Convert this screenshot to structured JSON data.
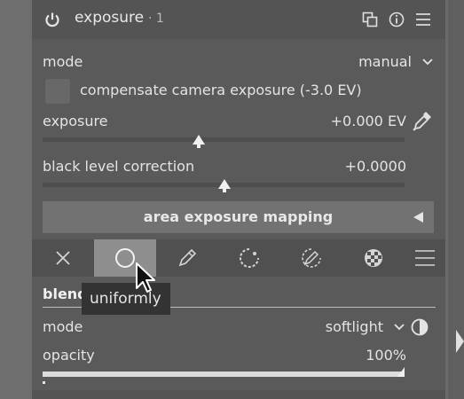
{
  "header": {
    "title": "exposure",
    "instance": "· 1",
    "icons": [
      "power-icon",
      "multi-instance-icon",
      "reset-icon",
      "presets-icon"
    ]
  },
  "mode": {
    "label": "mode",
    "value": "manual"
  },
  "compensate": {
    "label": "compensate camera exposure (-3.0 EV)",
    "checked": false
  },
  "exposure": {
    "label": "exposure",
    "value": "+0.000 EV",
    "picker_icon": "color-picker-icon"
  },
  "black_level": {
    "label": "black level correction",
    "value": "+0.0000"
  },
  "area_mapping": {
    "label": "area exposure mapping",
    "collapsed": true
  },
  "blend_modes": [
    {
      "name": "off",
      "icon": "close-icon"
    },
    {
      "name": "uniformly",
      "icon": "circle-icon",
      "active": true
    },
    {
      "name": "drawn mask",
      "icon": "pencil-icon"
    },
    {
      "name": "parametric mask",
      "icon": "parametric-icon"
    },
    {
      "name": "drawn & parametric mask",
      "icon": "pencil-parametric-icon"
    },
    {
      "name": "raster mask",
      "icon": "raster-icon"
    },
    {
      "name": "menu",
      "icon": "hamburger-icon"
    }
  ],
  "tooltip": {
    "text": "uniformly"
  },
  "blend": {
    "header": "blend",
    "mode_label": "mode",
    "mode_value": "softlight",
    "opacity_label": "opacity",
    "opacity_value": "100%",
    "opacity_fraction": 1.0
  },
  "colors": {
    "panel": "#5a5a5a",
    "active_tab": "#8e8e8e",
    "text": "#e4e4e4"
  }
}
